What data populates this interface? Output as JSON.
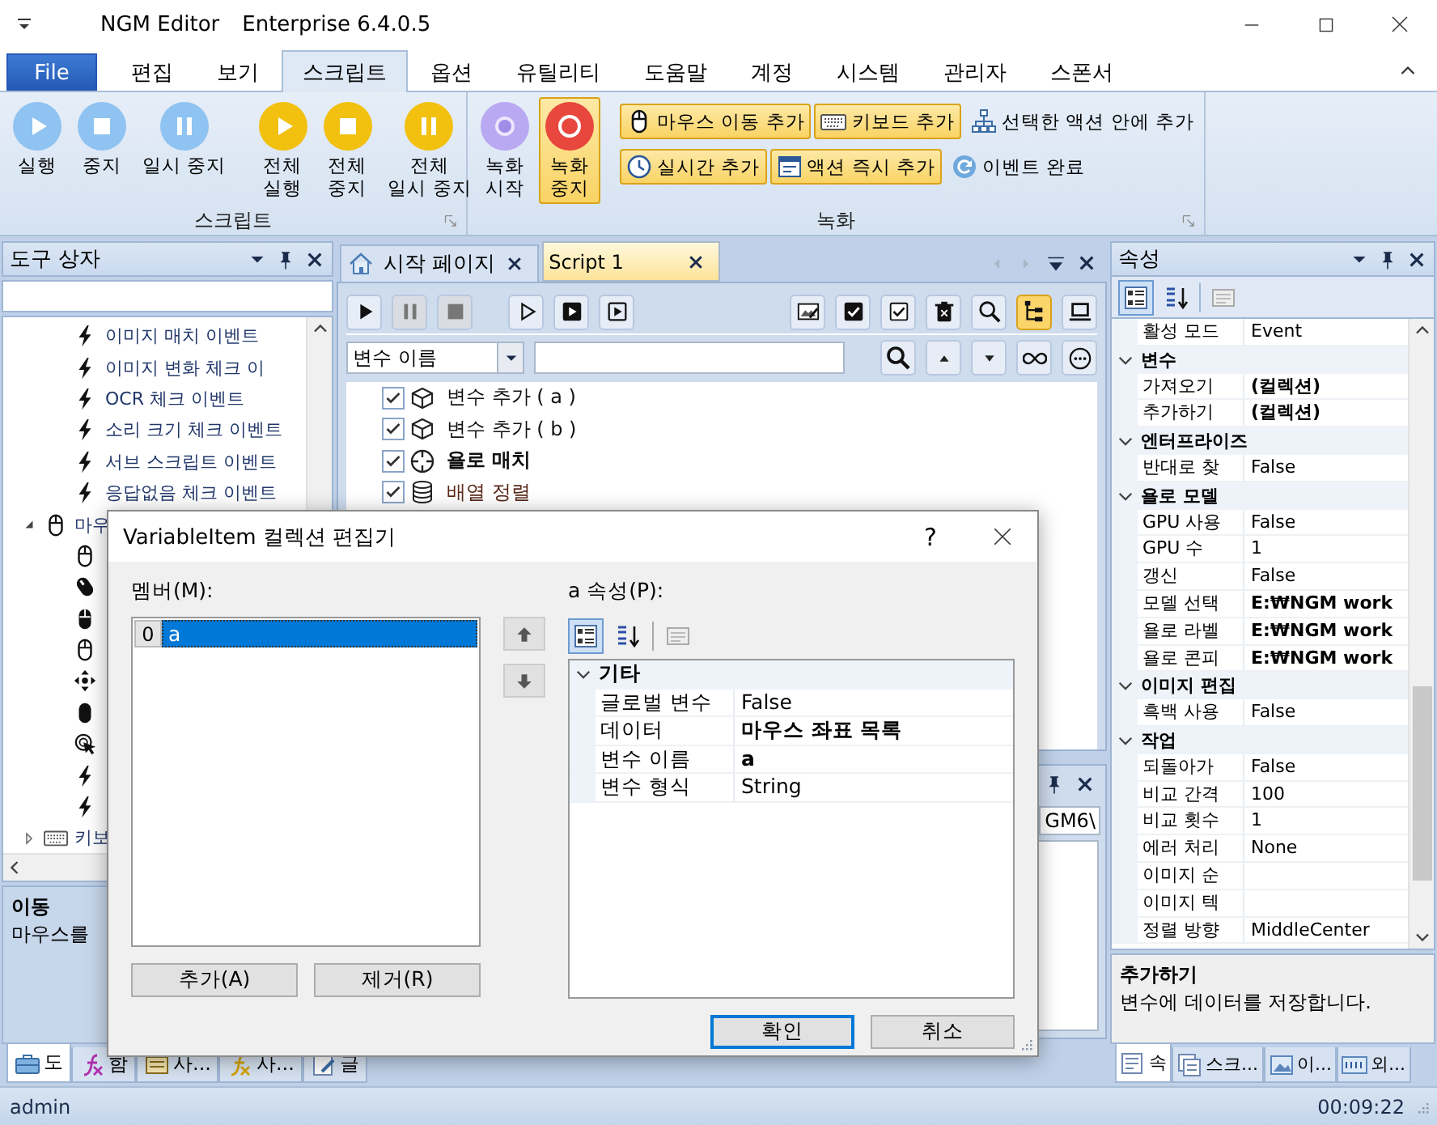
{
  "window": {
    "title": "NGM Editor",
    "edition": "Enterprise 6.4.0.5"
  },
  "menu": [
    {
      "label": "File",
      "kind": "file",
      "selected": false
    },
    {
      "label": "편집",
      "kind": "tab",
      "selected": false
    },
    {
      "label": "보기",
      "kind": "tab",
      "selected": false
    },
    {
      "label": "스크립트",
      "kind": "tab",
      "selected": true
    },
    {
      "label": "옵션",
      "kind": "tab",
      "selected": false
    },
    {
      "label": "유틸리티",
      "kind": "tab",
      "selected": false
    },
    {
      "label": "도움말",
      "kind": "tab",
      "selected": false
    },
    {
      "label": "계정",
      "kind": "tab",
      "selected": false
    },
    {
      "label": "시스템",
      "kind": "tab",
      "selected": false
    },
    {
      "label": "관리자",
      "kind": "tab",
      "selected": false
    },
    {
      "label": "스폰서",
      "kind": "tab",
      "selected": false
    }
  ],
  "ribbon": {
    "groups": [
      {
        "label": "스크립트",
        "buttons": [
          {
            "label": "실행",
            "kind": "play",
            "color": "#8fc3f1"
          },
          {
            "label": "중지",
            "kind": "stop",
            "color": "#8fc3f1"
          },
          {
            "label": "일시 중지",
            "kind": "pause",
            "color": "#8fc3f1"
          },
          {
            "label": "전체\n실행",
            "kind": "play",
            "color": "#f2c00f"
          },
          {
            "label": "전체\n중지",
            "kind": "stop",
            "color": "#f2c00f"
          },
          {
            "label": "전체\n일시 중지",
            "kind": "pause",
            "color": "#f2c00f"
          }
        ]
      },
      {
        "label": "녹화",
        "buttons": [
          {
            "label": "녹화\n시작",
            "kind": "record-start",
            "color": "#b9a8f2",
            "active": false
          },
          {
            "label": "녹화\n중지",
            "kind": "record",
            "color": "#e8473d",
            "active": true
          }
        ],
        "small_buttons": [
          {
            "label": "마우스 이동 추가",
            "kind": "mouse",
            "active": true
          },
          {
            "label": "키보드 추가",
            "kind": "keyboard",
            "active": true
          },
          {
            "label": "선택한 액션 안에 추가",
            "kind": "hierarchy",
            "active": false
          },
          {
            "label": "실시간 추가",
            "kind": "clock",
            "active": true
          },
          {
            "label": "액션 즉시 추가",
            "kind": "window",
            "active": true
          },
          {
            "label": "이벤트 완료",
            "kind": "refresh",
            "active": false
          }
        ]
      }
    ]
  },
  "toolbox": {
    "title": "도구 상자",
    "tree": [
      {
        "label": "이미지 매치 이벤트",
        "kind": "event"
      },
      {
        "label": "이미지 변화 체크 이",
        "kind": "event"
      },
      {
        "label": "OCR 체크 이벤트",
        "kind": "event"
      },
      {
        "label": "소리 크기 체크 이벤트",
        "kind": "event"
      },
      {
        "label": "서브 스크립트 이벤트",
        "kind": "event"
      },
      {
        "label": "응답없음 체크 이벤트",
        "kind": "event"
      },
      {
        "label": "마우",
        "kind": "mouse",
        "expanded": true,
        "children": [
          {
            "kind": "mouse"
          },
          {
            "kind": "mouse-scroll"
          },
          {
            "kind": "mouse-left"
          },
          {
            "kind": "mouse-outline"
          },
          {
            "kind": "move"
          },
          {
            "kind": "mouse-solid"
          },
          {
            "kind": "click"
          },
          {
            "kind": "event"
          },
          {
            "kind": "event"
          }
        ]
      },
      {
        "label": "키보",
        "kind": "keyboard",
        "expanded": false
      }
    ],
    "description": {
      "title": "이동",
      "text": "마우스를"
    },
    "tabs": [
      {
        "label": "도",
        "kind": "toolbox",
        "selected": true
      },
      {
        "label": "함",
        "kind": "function",
        "selected": false
      },
      {
        "label": "사...",
        "kind": "form",
        "selected": false
      },
      {
        "label": "사...",
        "kind": "function-alt",
        "selected": false
      },
      {
        "label": "글",
        "kind": "note",
        "selected": false
      }
    ]
  },
  "docs": {
    "tabs": [
      {
        "label": "시작 페이지",
        "kind": "home",
        "selected": false
      },
      {
        "label": "Script 1",
        "kind": "script",
        "selected": true
      }
    ],
    "toolbar": {
      "left": [
        {
          "kind": "run",
          "disabled": false,
          "active": false
        },
        {
          "kind": "pause",
          "disabled": true,
          "active": false
        },
        {
          "kind": "stop",
          "disabled": true,
          "active": false
        },
        {
          "kind": "run-outline",
          "disabled": false,
          "active": false
        },
        {
          "kind": "run-box",
          "disabled": false,
          "active": false
        },
        {
          "kind": "run-box-outline",
          "disabled": false,
          "active": false
        }
      ],
      "right": [
        {
          "kind": "image-edit",
          "disabled": false,
          "active": false
        },
        {
          "kind": "check-solid",
          "disabled": false,
          "active": false
        },
        {
          "kind": "check-outline",
          "disabled": false,
          "active": false
        },
        {
          "kind": "delete",
          "disabled": false,
          "active": false
        },
        {
          "kind": "zoom",
          "disabled": false,
          "active": false
        },
        {
          "kind": "tree",
          "disabled": false,
          "active": true
        },
        {
          "kind": "laptop",
          "disabled": false,
          "active": false
        }
      ]
    },
    "filter": {
      "field": "변수 이름"
    },
    "actions": [
      {
        "label": "변수 추가 ( a )",
        "kind": "variable",
        "checked": true,
        "bold": false
      },
      {
        "label": "변수 추가 ( b )",
        "kind": "variable",
        "checked": true,
        "bold": false
      },
      {
        "label": "욜로 매치",
        "kind": "yolo",
        "checked": true,
        "bold": true
      },
      {
        "label": "배열 정렬",
        "kind": "array",
        "checked": true,
        "bold": false
      }
    ],
    "output": {
      "path": "GM6\\"
    }
  },
  "properties": {
    "title": "속성",
    "grid": [
      {
        "kind": "row",
        "name": "활성 모드",
        "value": "Event",
        "modified": false
      },
      {
        "kind": "category",
        "label": "변수",
        "expanded": true
      },
      {
        "kind": "row",
        "name": "가져오기",
        "value": "(컬렉션)",
        "modified": true
      },
      {
        "kind": "row",
        "name": "추가하기",
        "value": "(컬렉션)",
        "modified": true
      },
      {
        "kind": "category",
        "label": "엔터프라이즈",
        "expanded": true
      },
      {
        "kind": "row",
        "name": "반대로 찾",
        "value": "False",
        "modified": false
      },
      {
        "kind": "category",
        "label": "욜로 모델",
        "expanded": true
      },
      {
        "kind": "row",
        "name": "GPU 사용",
        "value": "False",
        "modified": false
      },
      {
        "kind": "row",
        "name": "GPU 수",
        "value": "1",
        "modified": false
      },
      {
        "kind": "row",
        "name": "갱신",
        "value": "False",
        "modified": false
      },
      {
        "kind": "row",
        "name": "모델 선택",
        "value": "E:₩NGM work",
        "modified": true
      },
      {
        "kind": "row",
        "name": "욜로 라벨",
        "value": "E:₩NGM work",
        "modified": true
      },
      {
        "kind": "row",
        "name": "욜로 콘피",
        "value": "E:₩NGM work",
        "modified": true
      },
      {
        "kind": "category",
        "label": "이미지 편집",
        "expanded": true
      },
      {
        "kind": "row",
        "name": "흑백 사용",
        "value": "False",
        "modified": false
      },
      {
        "kind": "category",
        "label": "작업",
        "expanded": true
      },
      {
        "kind": "row",
        "name": "되돌아가",
        "value": "False",
        "modified": false
      },
      {
        "kind": "row",
        "name": "비교 간격",
        "value": "100",
        "modified": false
      },
      {
        "kind": "row",
        "name": "비교 횟수",
        "value": "1",
        "modified": false
      },
      {
        "kind": "row",
        "name": "에러 처리",
        "value": "None",
        "modified": false
      },
      {
        "kind": "row",
        "name": "이미지 순",
        "modified": false
      },
      {
        "kind": "row",
        "name": "이미지 텍",
        "modified": false
      },
      {
        "kind": "row",
        "name": "정렬 방향",
        "value": "MiddleCenter",
        "modified": false
      }
    ],
    "description": {
      "title": "추가하기",
      "text": "변수에 데이터를 저장합니다."
    },
    "tabs": [
      {
        "label": "속",
        "kind": "properties",
        "selected": true
      },
      {
        "label": "스크...",
        "kind": "script",
        "selected": false
      },
      {
        "label": "이...",
        "kind": "image",
        "selected": false
      },
      {
        "label": "외...",
        "kind": "api",
        "selected": false
      }
    ]
  },
  "dialog": {
    "title": "VariableItem 컬렉션 편집기",
    "help": "?",
    "members_label": "멤버(M):",
    "members": [
      {
        "index": "0",
        "name": "a",
        "selected": true
      }
    ],
    "add": "추가(A)",
    "remove": "제거(R)",
    "properties_label": "a 속성(P):",
    "grid": [
      {
        "kind": "category",
        "label": "기타",
        "expanded": true
      },
      {
        "kind": "row",
        "name": "글로벌 변수",
        "value": "False",
        "modified": false
      },
      {
        "kind": "row",
        "name": "데이터",
        "value": "마우스 좌표 목록",
        "modified": true
      },
      {
        "kind": "row",
        "name": "변수 이름",
        "value": "a",
        "modified": true
      },
      {
        "kind": "row",
        "name": "변수 형식",
        "value": "String",
        "modified": false
      }
    ],
    "ok": "확인",
    "cancel": "취소"
  },
  "status": {
    "user": "admin",
    "time": "00:09:22"
  }
}
